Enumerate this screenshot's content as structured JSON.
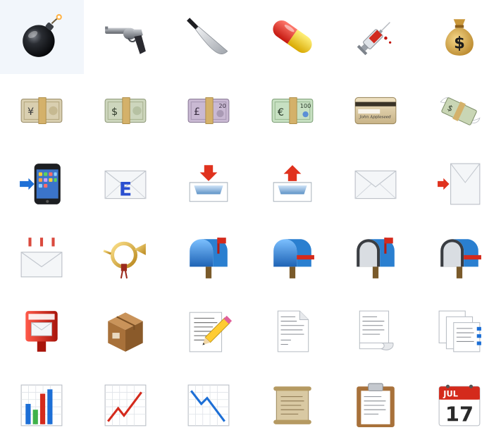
{
  "grid": {
    "columns": 6,
    "rows": 6,
    "icons": [
      {
        "name": "bomb-icon"
      },
      {
        "name": "revolver-icon"
      },
      {
        "name": "knife-icon"
      },
      {
        "name": "pill-icon"
      },
      {
        "name": "syringe-icon"
      },
      {
        "name": "money-bag-icon"
      },
      {
        "name": "yen-banknote-icon"
      },
      {
        "name": "dollar-banknote-icon"
      },
      {
        "name": "pound-banknote-icon"
      },
      {
        "name": "euro-banknote-icon"
      },
      {
        "name": "credit-card-icon"
      },
      {
        "name": "money-with-wings-icon"
      },
      {
        "name": "mobile-phone-with-arrow-icon"
      },
      {
        "name": "e-mail-icon"
      },
      {
        "name": "inbox-tray-icon"
      },
      {
        "name": "outbox-tray-icon"
      },
      {
        "name": "envelope-icon"
      },
      {
        "name": "incoming-envelope-icon"
      },
      {
        "name": "envelope-with-arrow-icon"
      },
      {
        "name": "postal-horn-icon"
      },
      {
        "name": "closed-mailbox-raised-flag-icon"
      },
      {
        "name": "closed-mailbox-lowered-flag-icon"
      },
      {
        "name": "open-mailbox-raised-flag-icon"
      },
      {
        "name": "open-mailbox-lowered-flag-icon"
      },
      {
        "name": "postbox-icon"
      },
      {
        "name": "package-icon"
      },
      {
        "name": "memo-icon"
      },
      {
        "name": "page-facing-up-icon"
      },
      {
        "name": "page-with-curl-icon"
      },
      {
        "name": "bookmark-tabs-icon"
      },
      {
        "name": "bar-chart-icon"
      },
      {
        "name": "chart-increasing-icon"
      },
      {
        "name": "chart-decreasing-icon"
      },
      {
        "name": "scroll-icon"
      },
      {
        "name": "clipboard-icon"
      },
      {
        "name": "calendar-icon"
      }
    ]
  },
  "banknotes": {
    "yen_symbol": "¥",
    "dollar_symbol": "$",
    "pound_symbol": "£",
    "pound_denomination": "20",
    "euro_symbol": "€",
    "euro_denomination": "100"
  },
  "money_bag_symbol": "$",
  "email_letter": "E",
  "credit_card_name": "John Appleseed",
  "calendar": {
    "month": "JUL",
    "day": "17"
  },
  "colors": {
    "mail_red": "#d42a1c",
    "mailbox_blue": "#2a7fd0",
    "note_green": "#cfe3c4",
    "note_tan": "#d9c9a3",
    "arrow_blue": "#1d6fd6",
    "arrow_red": "#e0321e"
  }
}
